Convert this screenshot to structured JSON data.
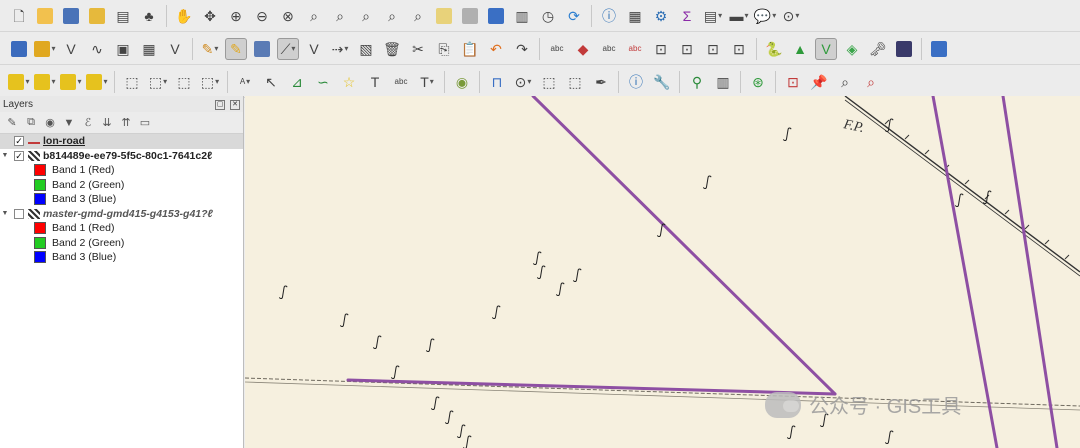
{
  "toolbar_row1": [
    "new-project-icon",
    "open-project-icon",
    "save-project-icon",
    "save-as-icon",
    "print-layout-icon",
    "style-manager-icon",
    "pan-icon",
    "pan-to-selection-icon",
    "zoom-in-icon",
    "zoom-out-icon",
    "zoom-full-icon",
    "zoom-selection-icon",
    "zoom-layer-icon",
    "zoom-native-icon",
    "zoom-last-icon",
    "zoom-next-icon",
    "new-bookmark-icon",
    "show-bookmarks-icon",
    "refresh-icon",
    "identify-icon",
    "attribute-table-icon",
    "settings-icon",
    "sum-icon",
    "open-table-icon",
    "measure-icon",
    "annotation-icon",
    "zoom-to-icon"
  ],
  "toolbar_row2": [
    "data-source-manager-icon",
    "add-layer-icon",
    "add-vector-icon",
    "digitize-icon",
    "add-wms-icon",
    "add-raster-icon",
    "add-virtual-icon",
    "pencil-icon",
    "toggle-editing-icon",
    "save-edits-icon",
    "add-line-icon",
    "vertex-tool-icon",
    "move-feature-icon",
    "delete-icon",
    "cut-icon",
    "copy-icon",
    "paste-icon",
    "undo-icon",
    "redo-icon",
    "label-icon",
    "label-highlight-icon",
    "abc-icon",
    "abc-red-icon",
    "python-icon",
    "terrain-icon",
    "plugin-icon",
    "stack-icon",
    "world-icon",
    "help-icon"
  ],
  "toolbar_row3": [
    "select-feature-icon",
    "deselect-icon",
    "select-by-value-icon",
    "select-polygon-icon",
    "digitize-segment-icon",
    "reshape-icon",
    "split-icon",
    "abc-text-icon",
    "pointer-icon",
    "add-point-icon",
    "add-node-icon",
    "star-icon",
    "text-tool-icon",
    "abc-tool-icon",
    "text-box-icon",
    "globe-icon",
    "pin-icon",
    "rotate-icon",
    "move-icon",
    "tag-icon",
    "info-icon",
    "wrench-icon",
    "plugin-green-icon",
    "share-icon",
    "bookmark-icon",
    "point-red-icon",
    "magnifier-icon"
  ],
  "layers_panel": {
    "title": "Layers",
    "layers": [
      {
        "name": "lon-road",
        "checked": true
      },
      {
        "name": "b814489e-ee79-5f5c-80c1-7641c2ℓ",
        "checked": true,
        "bands": [
          "Band 1 (Red)",
          "Band 2 (Green)",
          "Band 3 (Blue)"
        ]
      },
      {
        "name": "master-gmd-gmd415-g4153-g41?ℓ",
        "checked": false,
        "bands": [
          "Band 1 (Red)",
          "Band 2 (Green)",
          "Band 3 (Blue)"
        ]
      }
    ]
  },
  "map": {
    "label": "F.P.",
    "watermark": "公众号 · GIS工具",
    "road_color": "#8e4fa3"
  },
  "colors": {
    "red": "#ff0000",
    "green": "#22cc22",
    "blue": "#0000ff"
  }
}
